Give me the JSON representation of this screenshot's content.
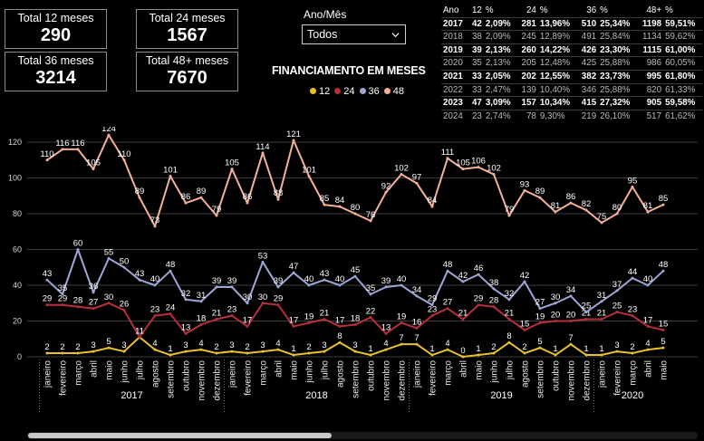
{
  "cards": [
    {
      "label": "Total 12 meses",
      "value": "290"
    },
    {
      "label": "Total 24 meses",
      "value": "1567"
    },
    {
      "label": "Total 36 meses",
      "value": "3214"
    },
    {
      "label": "Total 48+ meses",
      "value": "7670"
    }
  ],
  "slicer": {
    "label": "Ano/Mês",
    "value": "Todos"
  },
  "table": {
    "headers": [
      "Ano",
      "12",
      "%",
      "24",
      "%",
      "36",
      "%",
      "48+",
      "%"
    ],
    "rows": [
      [
        "2017",
        "42",
        "2,09%",
        "281",
        "13,96%",
        "510",
        "25,34%",
        "1198",
        "59,51%"
      ],
      [
        "2018",
        "38",
        "2,09%",
        "245",
        "12,89%",
        "491",
        "25,84%",
        "1134",
        "59,62%"
      ],
      [
        "2019",
        "39",
        "2,13%",
        "260",
        "14,22%",
        "426",
        "23,30%",
        "1115",
        "61,00%"
      ],
      [
        "2020",
        "35",
        "2,13%",
        "205",
        "12,48%",
        "425",
        "25,88%",
        "986",
        "60,05%"
      ],
      [
        "2021",
        "33",
        "2,05%",
        "202",
        "12,55%",
        "382",
        "23,73%",
        "995",
        "61,80%"
      ],
      [
        "2022",
        "33",
        "2,47%",
        "139",
        "10,40%",
        "346",
        "25,88%",
        "820",
        "61,33%"
      ],
      [
        "2023",
        "47",
        "3,09%",
        "157",
        "10,34%",
        "415",
        "27,32%",
        "905",
        "59,58%"
      ],
      [
        "2024",
        "23",
        "2,74%",
        "78",
        "9,30%",
        "219",
        "26,10%",
        "517",
        "61,62%"
      ]
    ]
  },
  "chart_data": {
    "type": "line",
    "title": "FINANCIAMENTO EM MESES",
    "ylim": [
      0,
      120
    ],
    "yticks": [
      0,
      20,
      40,
      60,
      80,
      100,
      120
    ],
    "grid": true,
    "legend_position": "top",
    "categories": [
      "janeiro",
      "fevereiro",
      "março",
      "abril",
      "maio",
      "junho",
      "julho",
      "agosto",
      "setembro",
      "outubro",
      "novembro",
      "dezembro",
      "janeiro",
      "fevereiro",
      "março",
      "abril",
      "maio",
      "junho",
      "julho",
      "agosto",
      "setembro",
      "outubro",
      "novembro",
      "dezembro",
      "janeiro",
      "fevereiro",
      "março",
      "abril",
      "maio",
      "junho",
      "julho",
      "agosto",
      "setembro",
      "outubro",
      "novembro",
      "dezembro",
      "janeiro",
      "fevereiro",
      "março",
      "abril",
      "maio"
    ],
    "years": [
      {
        "label": "2017",
        "count": 12
      },
      {
        "label": "2018",
        "count": 12
      },
      {
        "label": "2019",
        "count": 12
      },
      {
        "label": "2020",
        "count": 5
      }
    ],
    "series": [
      {
        "name": "12",
        "color": "#e8c22a",
        "values": [
          2,
          2,
          2,
          3,
          5,
          3,
          11,
          4,
          1,
          3,
          4,
          2,
          3,
          2,
          3,
          4,
          1,
          2,
          3,
          8,
          3,
          1,
          4,
          7,
          7,
          1,
          4,
          0,
          1,
          2,
          8,
          2,
          5,
          1,
          7,
          1,
          1,
          3,
          2,
          4,
          5
        ]
      },
      {
        "name": "24",
        "color": "#b82e3c",
        "values": [
          29,
          29,
          28,
          27,
          30,
          26,
          11,
          23,
          24,
          13,
          18,
          21,
          23,
          17,
          30,
          29,
          17,
          19,
          21,
          17,
          18,
          22,
          13,
          19,
          16,
          23,
          27,
          21,
          29,
          28,
          21,
          15,
          19,
          20,
          20,
          21,
          21,
          25,
          23,
          17,
          15
        ]
      },
      {
        "name": "36",
        "color": "#9ea6d6",
        "values": [
          43,
          35,
          60,
          36,
          55,
          50,
          43,
          40,
          48,
          32,
          31,
          39,
          39,
          30,
          53,
          39,
          47,
          40,
          43,
          40,
          45,
          35,
          39,
          40,
          34,
          29,
          48,
          42,
          46,
          38,
          32,
          42,
          27,
          30,
          34,
          25,
          31,
          37,
          44,
          40,
          48
        ]
      },
      {
        "name": "48",
        "color": "#f5b09a",
        "values": [
          110,
          116,
          116,
          105,
          124,
          110,
          89,
          73,
          101,
          86,
          89,
          79,
          105,
          86,
          114,
          88,
          121,
          101,
          85,
          84,
          80,
          76,
          92,
          102,
          97,
          84,
          111,
          105,
          106,
          102,
          79,
          93,
          89,
          81,
          86,
          82,
          75,
          80,
          95,
          81,
          85
        ]
      }
    ]
  }
}
